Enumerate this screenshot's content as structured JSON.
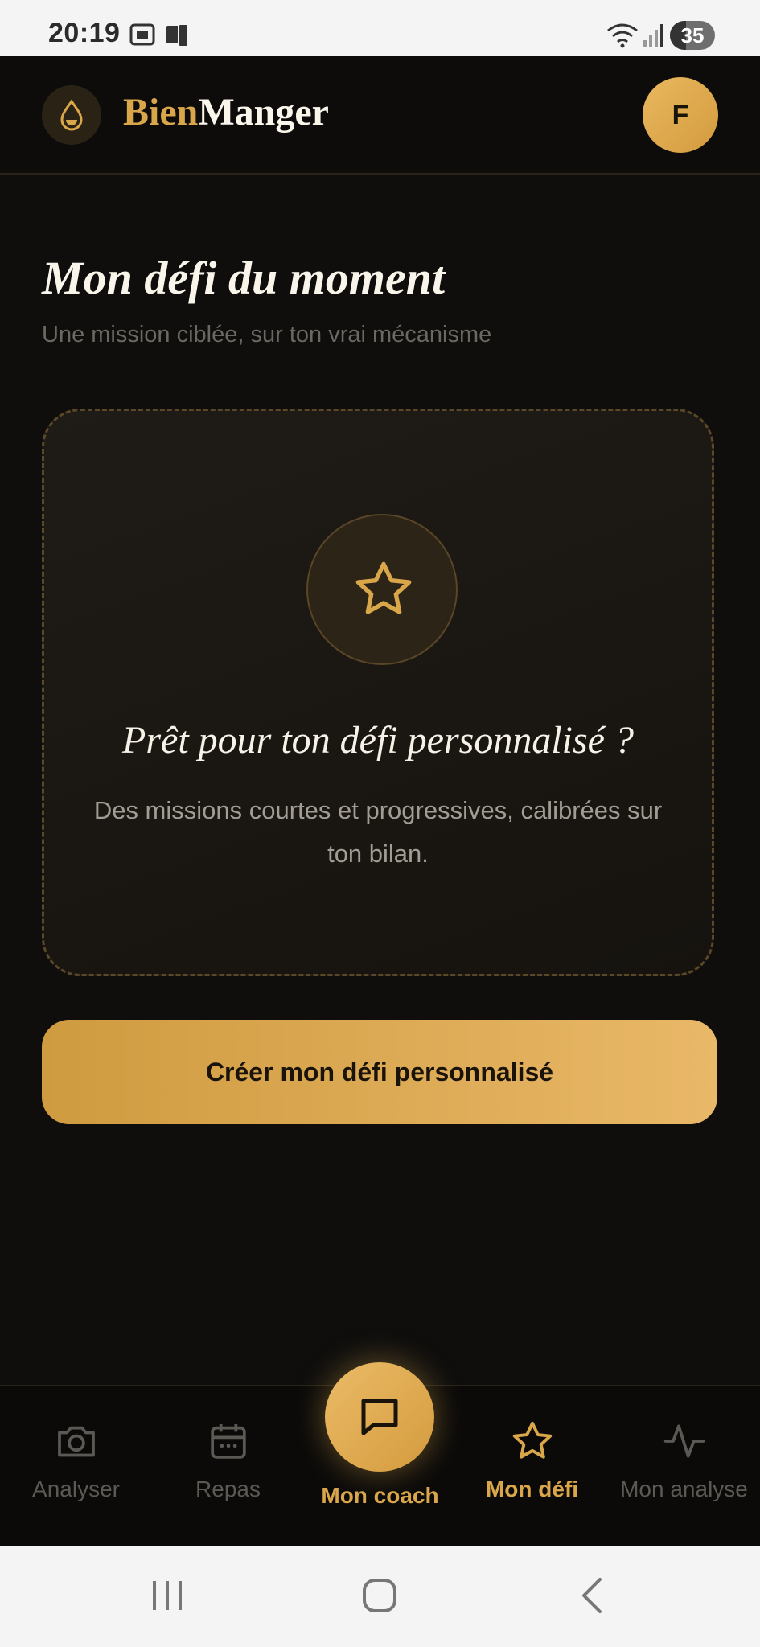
{
  "status_bar": {
    "time": "20:19",
    "battery": "35",
    "battery_level": 0.35
  },
  "header": {
    "brand_part1": "Bien",
    "brand_part2": "Manger",
    "avatar_initial": "F"
  },
  "page": {
    "title": "Mon défi du moment",
    "subtitle": "Une mission ciblée, sur ton vrai mécanisme"
  },
  "card": {
    "title": "Prêt pour ton défi personnalisé ?",
    "text": "Des missions courtes et progressives, calibrées sur ton bilan."
  },
  "cta_label": "Créer mon défi personnalisé",
  "nav": {
    "analyser": "Analyser",
    "repas": "Repas",
    "coach": "Mon coach",
    "defi": "Mon défi",
    "analyse": "Mon analyse"
  },
  "colors": {
    "accent": "#d9a64a",
    "background": "#0f0e0d",
    "inactive": "#5c5954"
  },
  "icons": {
    "logo": "drop-icon",
    "card": "star-icon",
    "analyser": "camera-icon",
    "repas": "calendar-icon",
    "coach": "chat-icon",
    "defi": "star-icon",
    "analyse": "activity-icon"
  }
}
